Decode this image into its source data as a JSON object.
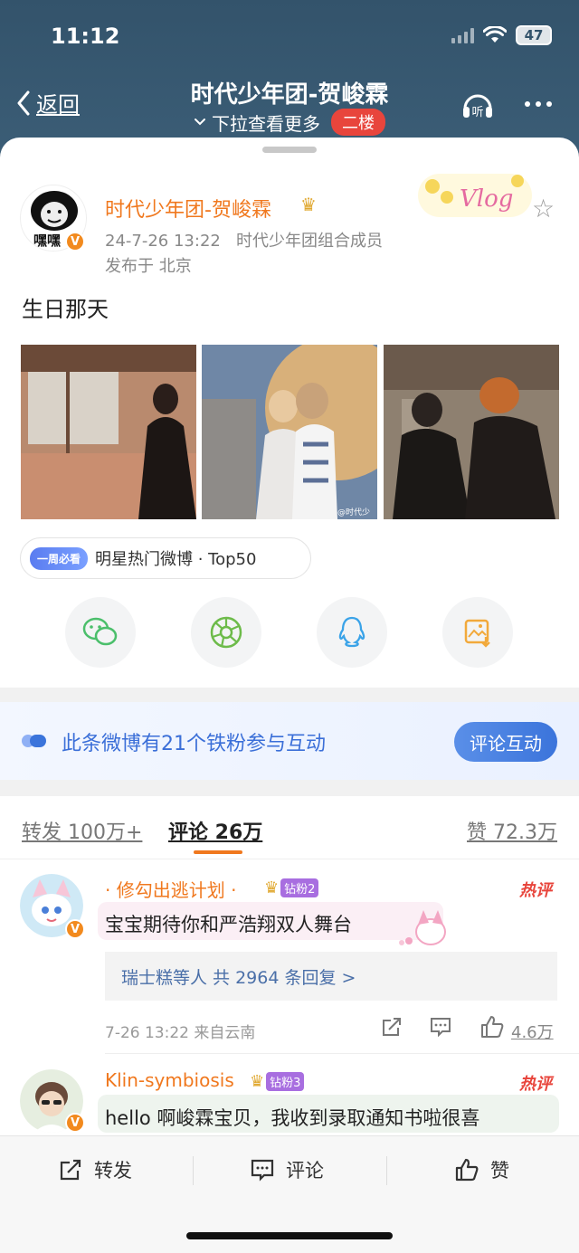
{
  "status": {
    "time": "11:12",
    "battery": "47"
  },
  "nav": {
    "back_label": "返回",
    "title": "时代少年团-贺峻霖",
    "subtitle": "下拉查看更多",
    "floor_badge": "二楼"
  },
  "post": {
    "author": "时代少年团-贺峻霖",
    "avatar_text": "嘿嘿",
    "date": "24-7-26 13:22",
    "author_desc": "时代少年团组合成员",
    "location": "发布于 北京",
    "text": "生日那天",
    "vlog_text": "Vlog",
    "photo_watermark": "@时代少",
    "hot_pill": "一周必看",
    "hot_tag": "明星热门微博 · Top50"
  },
  "share": {
    "icons": [
      "wechat-icon",
      "moments-icon",
      "qq-icon",
      "save-image-icon"
    ]
  },
  "iron_fans": {
    "text": "此条微博有21个铁粉参与互动",
    "button": "评论互动"
  },
  "tabs": {
    "repost": "转发 100万+",
    "comment": "评论 26万",
    "like": "赞 72.3万"
  },
  "comments": [
    {
      "name": "· 修勾出逃计划 ·",
      "fan_level": "钻粉2",
      "hot": "热评",
      "text": "宝宝期待你和严浩翔双人舞台",
      "replies": "瑞士糕等人 共 2964 条回复 >",
      "time": "7-26 13:22 来自云南",
      "likes": "4.6万"
    },
    {
      "name": "Klin-symbiosis",
      "fan_level": "钻粉3",
      "hot": "热评",
      "text": "hello 啊峻霖宝贝，我收到录取通知书啦很喜"
    }
  ],
  "bottom_bar": {
    "repost": "转发",
    "comment": "评论",
    "like": "赞"
  },
  "colors": {
    "accent_orange": "#f0781e",
    "header_bg": "#3b5d76",
    "link_blue": "#3b6fd8",
    "hot_red": "#e8453c"
  }
}
